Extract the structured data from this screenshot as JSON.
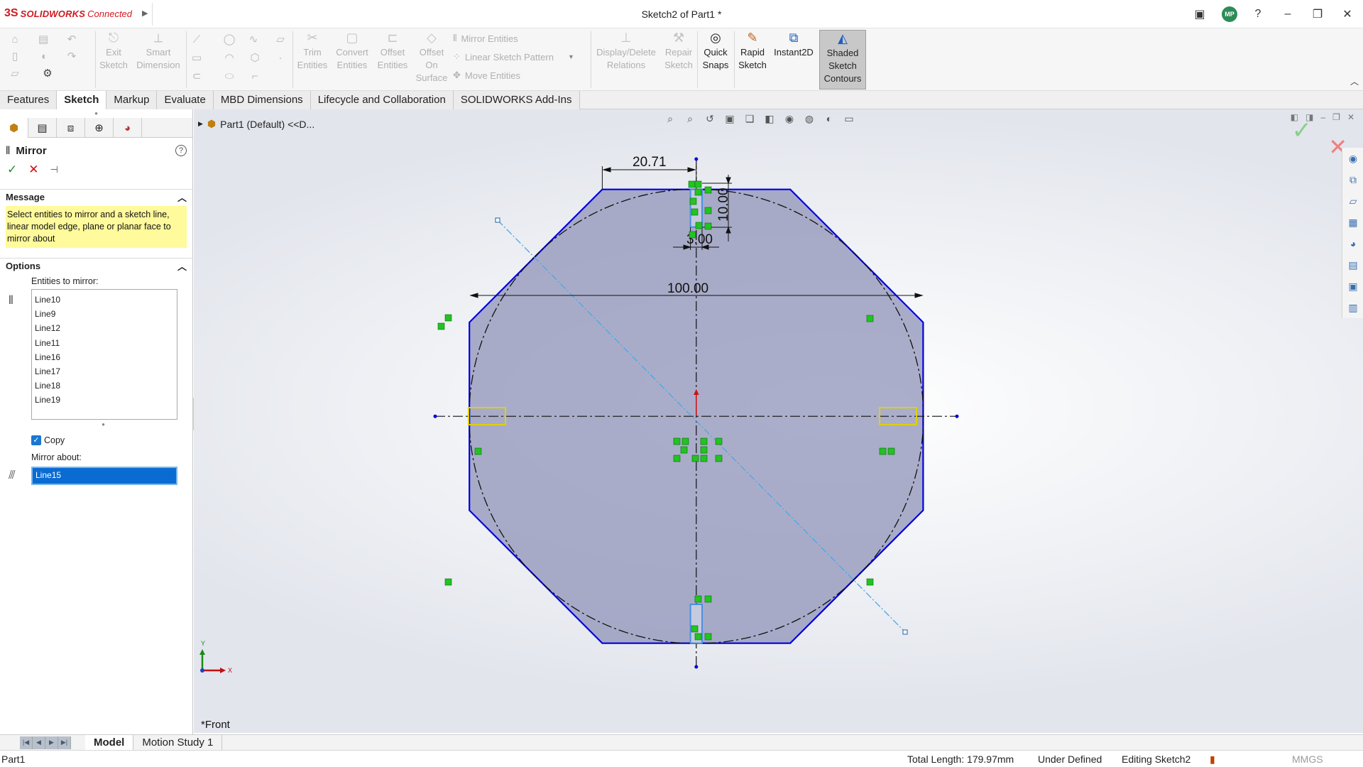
{
  "titlebar": {
    "brand_prefix": "3S",
    "brand_main": "SOLIDWORKS",
    "brand_suffix": "Connected",
    "doc_title": "Sketch2 of Part1 *",
    "avatar_initials": "MP"
  },
  "commands": {
    "exit_sketch": "Exit Sketch",
    "smart_dimension": "Smart Dimension",
    "trim_entities": "Trim Entities",
    "convert_entities": "Convert Entities",
    "offset_entities": "Offset Entities",
    "offset_on_surface": "Offset On Surface",
    "mirror_entities": "Mirror Entities",
    "linear_sketch_pattern": "Linear Sketch Pattern",
    "move_entities": "Move Entities",
    "display_delete_relations": "Display/Delete Relations",
    "repair_sketch": "Repair Sketch",
    "quick_snaps": "Quick Snaps",
    "rapid_sketch": "Rapid Sketch",
    "instant2d": "Instant2D",
    "shaded_sketch_contours": "Shaded Sketch Contours"
  },
  "tabs": [
    "Features",
    "Sketch",
    "Markup",
    "Evaluate",
    "MBD Dimensions",
    "Lifecycle and Collaboration",
    "SOLIDWORKS Add-Ins"
  ],
  "active_tab": "Sketch",
  "property_manager": {
    "title": "Mirror",
    "message_header": "Message",
    "message": "Select entities to mirror and a sketch line, linear model edge, plane or planar face to mirror about",
    "options_header": "Options",
    "entities_label": "Entities to mirror:",
    "entities": [
      "Line10",
      "Line9",
      "Line12",
      "Line11",
      "Line16",
      "Line17",
      "Line18",
      "Line19"
    ],
    "copy_label": "Copy",
    "copy_checked": true,
    "mirror_about_label": "Mirror about:",
    "mirror_about_value": "Line15"
  },
  "graphics": {
    "tree_root": "Part1 (Default) <<D...",
    "view_name": "*Front",
    "dimensions": {
      "top_width": "20.71",
      "slot_depth": "10.00",
      "slot_width": "3.00",
      "diameter": "100.00"
    },
    "axis_y": "Y",
    "axis_x": "X"
  },
  "bottom_tabs": [
    "Model",
    "Motion Study 1"
  ],
  "status": {
    "doc": "Part1",
    "total_length": "Total Length: 179.97mm",
    "definition": "Under Defined",
    "mode": "Editing Sketch2",
    "units": "MMGS"
  },
  "colors": {
    "brand": "#d01920",
    "sketch_line": "#0000e0",
    "sketch_fill": "#8f93b8",
    "relation_marker": "#22c322",
    "message_bg": "#fffa9b",
    "selection": "#0a6bd3"
  }
}
